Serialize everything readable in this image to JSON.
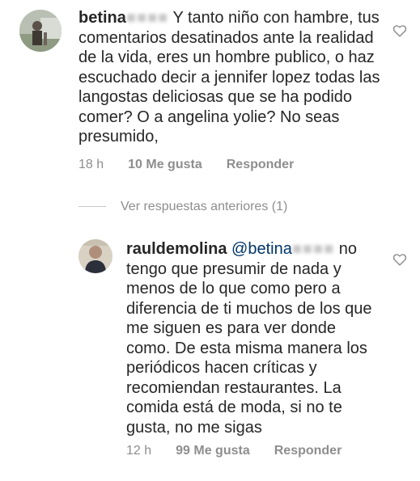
{
  "comment1": {
    "username": "betina",
    "username_hidden": "■■■■",
    "text": "Y tanto niño con hambre, tus comentarios desatinados ante la realidad de la vida, eres un hombre publico, o haz escuchado decir a jennifer lopez todas las langostas deliciosas que se ha podido comer? O a angelina yolie? No seas presumido,",
    "time": "18 h",
    "likes": "10 Me gusta",
    "reply": "Responder",
    "like_icon": "heart-outline-icon"
  },
  "view_replies": "Ver respuestas anteriores (1)",
  "reply1": {
    "username": "rauldemolina",
    "mention": "@betina",
    "mention_hidden": "■■■■",
    "text": "no tengo que presumir de nada y menos de lo que como pero a diferencia de ti muchos de los que me siguen es para ver donde como. De esta misma manera los periódicos hacen críticas y recomiendan restaurantes. La comida  está de moda,  si no te gusta, no me sigas",
    "time": "12 h",
    "likes": "99 Me gusta",
    "reply": "Responder",
    "like_icon": "heart-outline-icon"
  },
  "colors": {
    "text": "#262626",
    "meta": "#8e8e8e",
    "mention": "#003569"
  }
}
